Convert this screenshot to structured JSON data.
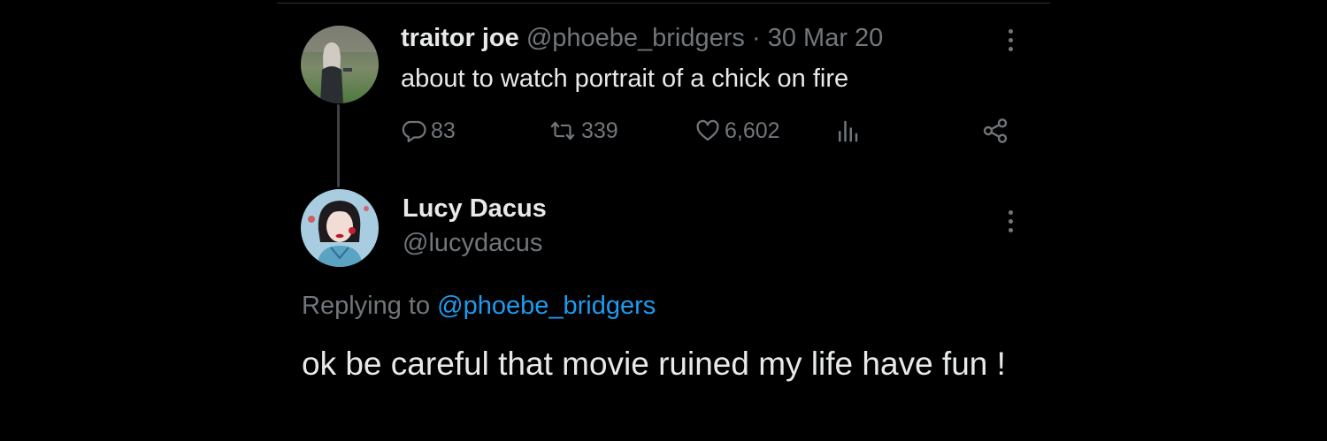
{
  "parent_tweet": {
    "display_name": "traitor joe",
    "handle": "@phoebe_bridgers",
    "separator": "·",
    "date": "30 Mar 20",
    "text": "about to watch portrait of a chick on fire",
    "stats": {
      "replies": "83",
      "reposts": "339",
      "likes": "6,602"
    }
  },
  "reply_tweet": {
    "display_name": "Lucy Dacus",
    "handle": "@lucydacus",
    "replying_to_prefix": "Replying to",
    "replying_to_handle": "@phoebe_bridgers",
    "text": "ok be careful that movie ruined my life have fun !"
  },
  "colors": {
    "background": "#000000",
    "primary_text": "#e7e9ea",
    "secondary_text": "#71767b",
    "link": "#1d9bf0",
    "thread_line": "#3e4144"
  },
  "icons": {
    "reply": "reply-icon",
    "repost": "repost-icon",
    "like": "heart-icon",
    "views": "views-icon",
    "share": "share-icon",
    "more": "more-icon"
  }
}
